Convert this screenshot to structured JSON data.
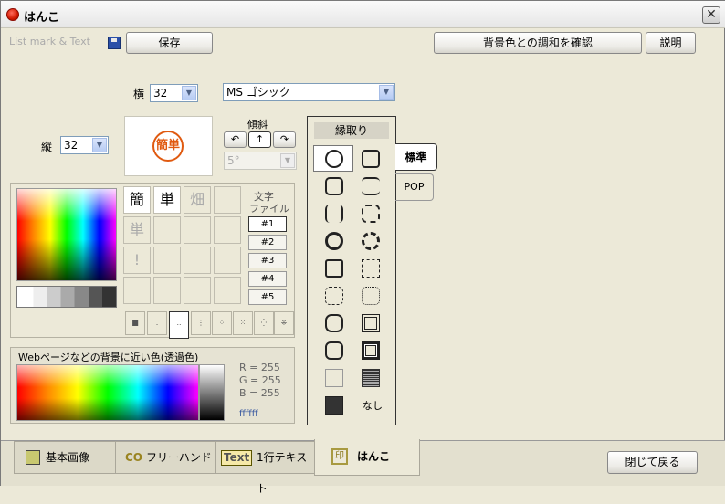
{
  "window": {
    "title": "はんこ",
    "close": "✕"
  },
  "toolbar": {
    "list_mark_text": "List mark & Text",
    "save": "保存",
    "check_bg": "背景色との調和を確認",
    "help": "説明"
  },
  "size": {
    "width_label": "横",
    "width_value": "32",
    "height_label": "縦",
    "height_value": "32"
  },
  "font": {
    "value": "MS ゴシック"
  },
  "preview": {
    "text": "簡単"
  },
  "slant": {
    "label": "傾斜",
    "angle": "5°",
    "left": "↶",
    "up": "↑",
    "right": "↷"
  },
  "chars": {
    "cells": [
      "簡",
      "単",
      "畑",
      "",
      "単",
      "",
      "",
      "",
      "!",
      "",
      "",
      "",
      "",
      "",
      "",
      ""
    ],
    "file_label_1": "文字",
    "file_label_2": "ファイル",
    "files": [
      "#1",
      "#2",
      "#3",
      "#4",
      "#5"
    ]
  },
  "grid_tabs": [
    "■",
    "⁚",
    "⁚⁚",
    "⋮",
    "⁘",
    "⁙",
    "⁛",
    "⁜"
  ],
  "border": {
    "header": "縁取り",
    "tab_standard": "標準",
    "tab_pop": "POP",
    "none_label": "なし"
  },
  "web": {
    "label": "Webページなどの背景に近い色(透過色)",
    "r": "R = 255",
    "g": "G = 255",
    "b": "B = 255",
    "hex": "ffffff"
  },
  "bottom_tabs": {
    "basic": "基本画像",
    "free": "フリーハンド",
    "oneline_badge": "Text",
    "oneline": "1行テキスト",
    "hanko_icon": "印",
    "hanko": "はんこ"
  },
  "close_button": "閉じて戻る",
  "colors": {
    "accent_red": "#e05a10",
    "panel_bg": "#ece9d8"
  }
}
